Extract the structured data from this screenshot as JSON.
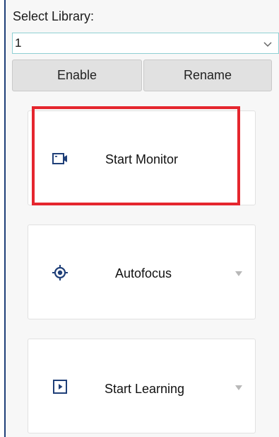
{
  "library": {
    "label": "Select Library:",
    "selected_value": "1",
    "chevron_icon": "chevron-down-icon"
  },
  "buttons": {
    "enable": "Enable",
    "rename": "Rename"
  },
  "actions": [
    {
      "label": "Start Monitor",
      "icon": "camera-icon",
      "highlighted": true
    },
    {
      "label": "Autofocus",
      "icon": "crosshair-icon",
      "has_dropdown": true
    },
    {
      "label": "Start Learning",
      "icon": "play-icon",
      "has_dropdown": true
    }
  ],
  "colors": {
    "accent": "#1f3f78",
    "highlight": "#e5262e",
    "dropdown_border": "#8fd0d4"
  }
}
